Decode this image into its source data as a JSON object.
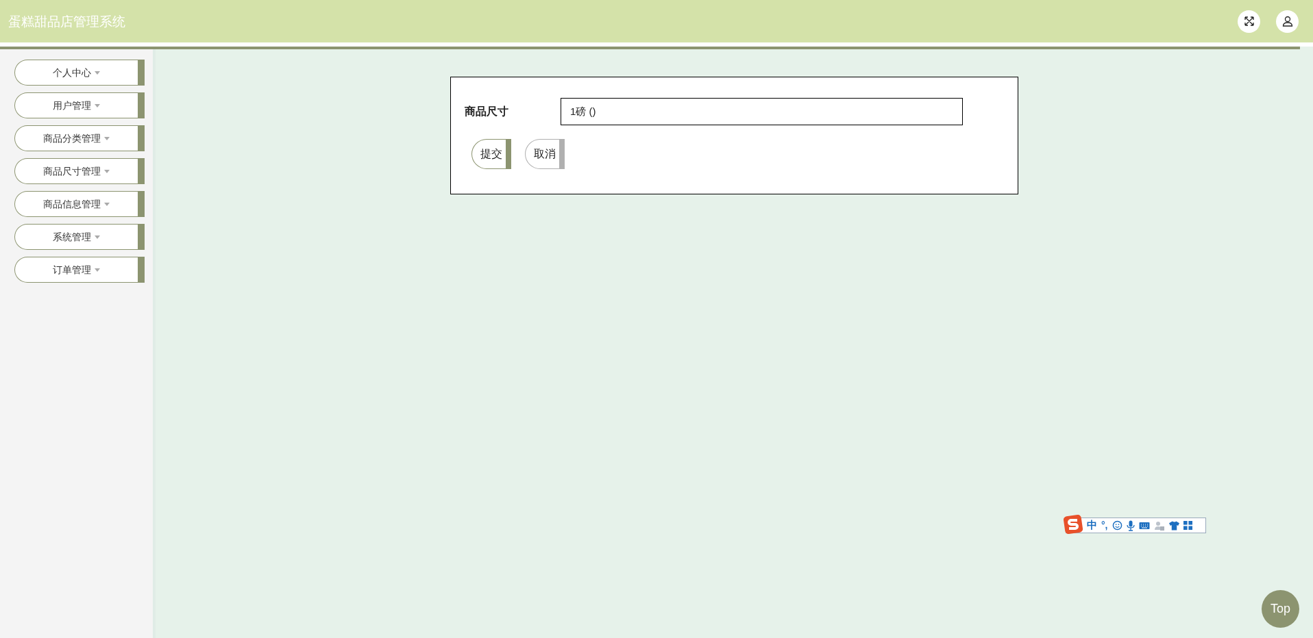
{
  "header": {
    "title": "蛋糕甜品店管理系统"
  },
  "sidebar": {
    "items": [
      {
        "label": "个人中心",
        "expanded": false
      },
      {
        "label": "用户管理",
        "expanded": false
      },
      {
        "label": "商品分类管理",
        "expanded": false
      },
      {
        "label": "商品尺寸管理",
        "expanded": false
      },
      {
        "label": "商品信息管理",
        "expanded": false
      },
      {
        "label": "系统管理",
        "expanded": false
      },
      {
        "label": "订单管理",
        "expanded": false
      }
    ]
  },
  "form": {
    "fields": [
      {
        "label": "商品尺寸",
        "value": "1磅 ()"
      }
    ],
    "buttons": [
      {
        "label": "提交",
        "kind": "primary"
      },
      {
        "label": "取消",
        "kind": "secondary"
      }
    ]
  },
  "ime_toolbar": {
    "mode": "中",
    "punctuation": "°,"
  },
  "back_to_top": "Top"
}
